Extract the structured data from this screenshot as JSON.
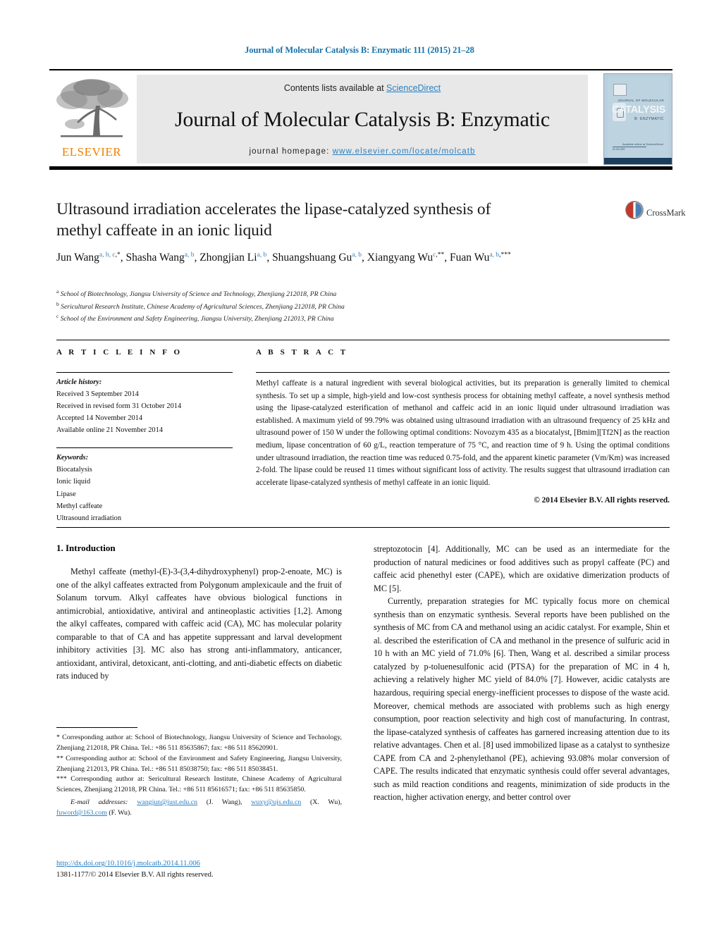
{
  "running_head": "Journal of Molecular Catalysis B: Enzymatic 111 (2015) 21–28",
  "masthead": {
    "contents_prefix": "Contents lists available at ",
    "contents_link": "ScienceDirect",
    "journal_title": "Journal of Molecular Catalysis B: Enzymatic",
    "homepage_label": "journal homepage:",
    "homepage_url": "www.elsevier.com/locate/molcatb",
    "publisher_wordmark": "ELSEVIER",
    "publisher_color": "#f08000",
    "link_color": "#2a7fc1",
    "cover": {
      "line_small": "JOURNAL OF MOLECULAR",
      "line_big": "CATALYSIS",
      "line_sub": "B: ENZYMATIC",
      "foot_right": "Available online at\nScienceDirect",
      "foot_left": "ELSEVIER"
    }
  },
  "crossmark": {
    "label": "CrossMark"
  },
  "article": {
    "title_line1": "Ultrasound irradiation accelerates the lipase-catalyzed synthesis of",
    "title_line2": "methyl caffeate in an ionic liquid",
    "authors": [
      {
        "name": "Jun Wang",
        "marks": "a, b, c",
        "star": ",*"
      },
      {
        "name": "Shasha Wang",
        "marks": "a, b",
        "star": ""
      },
      {
        "name": "Zhongjian Li",
        "marks": "a, b",
        "star": ""
      },
      {
        "name": "Shuangshuang Gu",
        "marks": "a, b",
        "star": ""
      },
      {
        "name": "Xiangyang Wu",
        "marks": "c",
        "star": ",**"
      },
      {
        "name": "Fuan Wu",
        "marks": "a, b",
        "star": ",***"
      }
    ],
    "affiliations": [
      {
        "mark": "a",
        "text": "School of Biotechnology, Jiangsu University of Science and Technology, Zhenjiang 212018, PR China"
      },
      {
        "mark": "b",
        "text": "Sericultural Research Institute, Chinese Academy of Agricultural Sciences, Zhenjiang 212018, PR China"
      },
      {
        "mark": "c",
        "text": "School of the Environment and Safety Engineering, Jiangsu University, Zhenjiang 212013, PR China"
      }
    ]
  },
  "article_info": {
    "header": "A R T I C L E  I N F O",
    "history_label": "Article history:",
    "history": [
      "Received 3 September 2014",
      "Received in revised form 31 October 2014",
      "Accepted 14 November 2014",
      "Available online 21 November 2014"
    ],
    "keywords_label": "Keywords:",
    "keywords": [
      "Biocatalysis",
      "Ionic liquid",
      "Lipase",
      "Methyl caffeate",
      "Ultrasound irradiation"
    ]
  },
  "abstract": {
    "header": "A B S T R A C T",
    "text": "Methyl caffeate is a natural ingredient with several biological activities, but its preparation is generally limited to chemical synthesis. To set up a simple, high-yield and low-cost synthesis process for obtaining methyl caffeate, a novel synthesis method using the lipase-catalyzed esterification of methanol and caffeic acid in an ionic liquid under ultrasound irradiation was established. A maximum yield of 99.79% was obtained using ultrasound irradiation with an ultrasound frequency of 25 kHz and ultrasound power of 150 W under the following optimal conditions: Novozym 435 as a biocatalyst, [Bmim][Tf2N] as the reaction medium, lipase concentration of 60 g/L, reaction temperature of 75 °C, and reaction time of 9 h. Using the optimal conditions under ultrasound irradiation, the reaction time was reduced 0.75-fold, and the apparent kinetic parameter (Vm/Km) was increased 2-fold. The lipase could be reused 11 times without significant loss of activity. The results suggest that ultrasound irradiation can accelerate lipase-catalyzed synthesis of methyl caffeate in an ionic liquid.",
    "copyright": "© 2014 Elsevier B.V. All rights reserved."
  },
  "body": {
    "section_number_title": "1.  Introduction",
    "left_paragraphs": [
      "Methyl caffeate (methyl-(E)-3-(3,4-dihydroxyphenyl) prop-2-enoate, MC) is one of the alkyl caffeates extracted from Polygonum amplexicaule and the fruit of Solanum torvum. Alkyl caffeates have obvious biological functions in antimicrobial, antioxidative, antiviral and antineoplastic activities [1,2]. Among the alkyl caffeates, compared with caffeic acid (CA), MC has molecular polarity comparable to that of CA and has appetite suppressant and larval development inhibitory activities [3]. MC also has strong anti-inflammatory, anticancer, antioxidant, antiviral, detoxicant, anti-clotting, and anti-diabetic effects on diabetic rats induced by"
    ],
    "right_paragraphs": [
      "streptozotocin [4]. Additionally, MC can be used as an intermediate for the production of natural medicines or food additives such as propyl caffeate (PC) and caffeic acid phenethyl ester (CAPE), which are oxidative dimerization products of MC [5].",
      "Currently, preparation strategies for MC typically focus more on chemical synthesis than on enzymatic synthesis. Several reports have been published on the synthesis of MC from CA and methanol using an acidic catalyst. For example, Shin et al. described the esterification of CA and methanol in the presence of sulfuric acid in 10 h with an MC yield of 71.0% [6]. Then, Wang et al. described a similar process catalyzed by p-toluenesulfonic acid (PTSA) for the preparation of MC in 4 h, achieving a relatively higher MC yield of 84.0% [7]. However, acidic catalysts are hazardous, requiring special energy-inefficient processes to dispose of the waste acid. Moreover, chemical methods are associated with problems such as high energy consumption, poor reaction selectivity and high cost of manufacturing. In contrast, the lipase-catalyzed synthesis of caffeates has garnered increasing attention due to its relative advantages. Chen et al. [8] used immobilized lipase as a catalyst to synthesize CAPE from CA and 2-phenylethanol (PE), achieving 93.08% molar conversion of CAPE. The results indicated that enzymatic synthesis could offer several advantages, such as mild reaction conditions and reagents, minimization of side products in the reaction, higher activation energy, and better control over"
    ]
  },
  "footnotes": {
    "items": [
      "* Corresponding author at: School of Biotechnology, Jiangsu University of Science and Technology, Zhenjiang 212018, PR China. Tel.: +86 511 85635867; fax: +86 511 85620901.",
      "** Corresponding author at: School of the Environment and Safety Engineering, Jiangsu University, Zhenjiang 212013, PR China. Tel.: +86 511 85038750; fax: +86 511 85038451.",
      "*** Corresponding author at: Sericultural Research Institute, Chinese Academy of Agricultural Sciences, Zhenjiang 212018, PR China. Tel.: +86 511 85616571; fax: +86 511 85635850."
    ],
    "email_label": "E-mail addresses:",
    "emails": [
      {
        "address": "wangjun@just.edu.cn",
        "owner": "(J. Wang)"
      },
      {
        "address": "wuxy@ujs.edu.cn",
        "owner": "(X. Wu)"
      },
      {
        "address": "fuword@163.com",
        "owner": "(F. Wu)"
      }
    ]
  },
  "doi_block": {
    "doi": "http://dx.doi.org/10.1016/j.molcatb.2014.11.006",
    "issn": "1381-1177/© 2014 Elsevier B.V. All rights reserved."
  }
}
